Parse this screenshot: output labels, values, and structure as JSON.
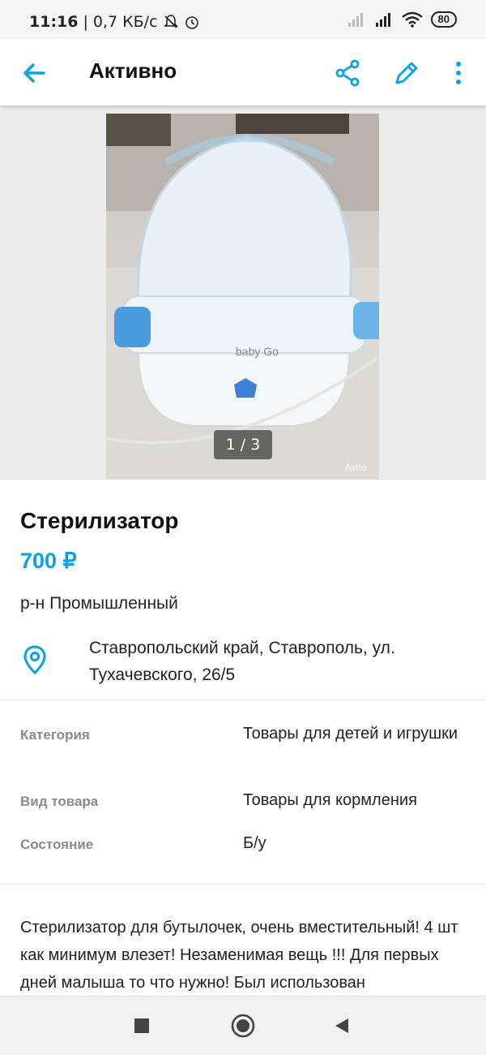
{
  "status_bar": {
    "time": "11:16",
    "speed": "0,7 КБ/с",
    "battery": "80"
  },
  "app_bar": {
    "title": "Активно",
    "back_icon": "arrow-left-icon",
    "share_icon": "share-icon",
    "edit_icon": "pencil-icon",
    "more_icon": "more-vertical-icon",
    "accent_color": "#0aa1e6"
  },
  "gallery": {
    "counter": "1 / 3",
    "watermark": "Avito",
    "product_brand": "baby Go"
  },
  "listing": {
    "title": "Стерилизатор",
    "price": "700 ₽",
    "district": "р-н Промышленный",
    "address": "Ставропольский край, Ставрополь, ул. Тухачевского, 26/5"
  },
  "params": [
    {
      "label": "Категория",
      "value": "Товары для детей и игрушки"
    },
    {
      "label": "Вид товара",
      "value": "Товары для кормления"
    },
    {
      "label": "Состояние",
      "value": "Б/у"
    }
  ],
  "description": "Стерилизатор для бутылочек, очень вместительный! 4 шт как минимум влезет! Незаменимая вещь !!! Для первых дней малыша то что нужно! Был использован",
  "nav_bar": {
    "recents_icon": "square-icon",
    "home_icon": "circle-icon",
    "back_icon": "triangle-back-icon"
  }
}
